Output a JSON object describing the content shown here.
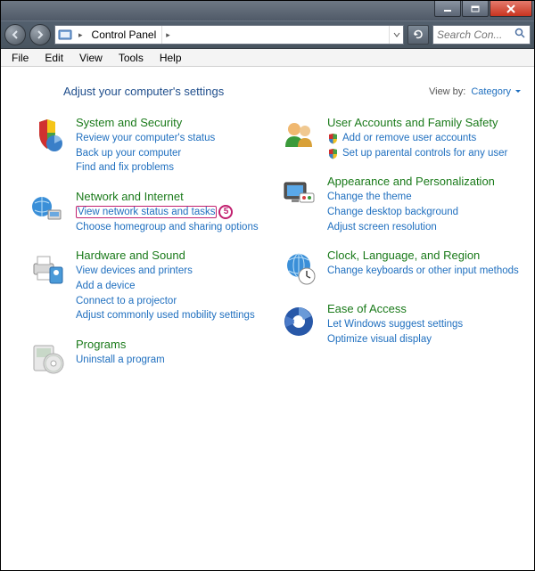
{
  "breadcrumb": {
    "root": "Control Panel"
  },
  "search": {
    "placeholder": "Search Con..."
  },
  "menu": {
    "file": "File",
    "edit": "Edit",
    "view": "View",
    "tools": "Tools",
    "help": "Help"
  },
  "heading": "Adjust your computer's settings",
  "viewby_label": "View by:",
  "viewby_value": "Category",
  "annotation": "5",
  "left": [
    {
      "title": "System and Security",
      "icon": "shield-chart",
      "links": [
        "Review your computer's status",
        "Back up your computer",
        "Find and fix problems"
      ]
    },
    {
      "title": "Network and Internet",
      "icon": "globe-network",
      "links": [
        "View network status and tasks",
        "Choose homegroup and sharing options"
      ],
      "highlight_index": 0
    },
    {
      "title": "Hardware and Sound",
      "icon": "printer-devices",
      "links": [
        "View devices and printers",
        "Add a device",
        "Connect to a projector",
        "Adjust commonly used mobility settings"
      ]
    },
    {
      "title": "Programs",
      "icon": "disc-box",
      "links": [
        "Uninstall a program"
      ]
    }
  ],
  "right": [
    {
      "title": "User Accounts and Family Safety",
      "icon": "people",
      "links": [
        "Add or remove user accounts",
        "Set up parental controls for any user"
      ],
      "shields": [
        0,
        1
      ]
    },
    {
      "title": "Appearance and Personalization",
      "icon": "monitor-paint",
      "links": [
        "Change the theme",
        "Change desktop background",
        "Adjust screen resolution"
      ]
    },
    {
      "title": "Clock, Language, and Region",
      "icon": "globe-clock",
      "links": [
        "Change keyboards or other input methods"
      ]
    },
    {
      "title": "Ease of Access",
      "icon": "access-ring",
      "links": [
        "Let Windows suggest settings",
        "Optimize visual display"
      ]
    }
  ]
}
